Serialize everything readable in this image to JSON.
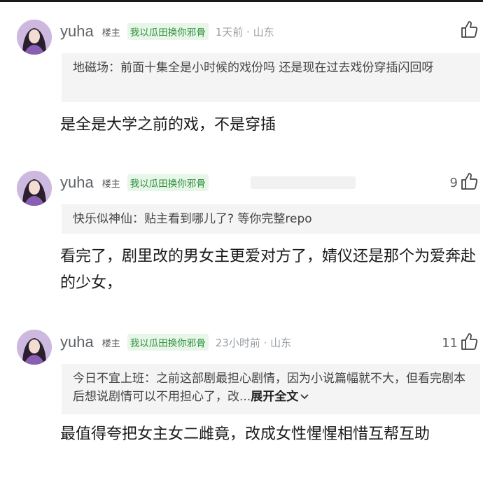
{
  "comments": [
    {
      "username": "yuha",
      "op_badge": "楼主",
      "tag": "我以瓜田换你邪骨",
      "time_location": "1天前 · 山东",
      "like_count": "",
      "quote_user": "地磁场：",
      "quote_text": "前面十集全是小时候的戏份吗 还是现在过去戏份穿插闪回呀",
      "body": "是全是大学之前的戏，不是穿插"
    },
    {
      "username": "yuha",
      "op_badge": "楼主",
      "tag": "我以瓜田换你邪骨",
      "time_location": "",
      "like_count": "9",
      "quote_user": "快乐似神仙：",
      "quote_text": "贴主看到哪儿了? 等你完整repo",
      "body": "看完了，剧里改的男女主更爱对方了，婧仪还是那个为爱奔赴的少女，"
    },
    {
      "username": "yuha",
      "op_badge": "楼主",
      "tag": "我以瓜田换你邪骨",
      "time_location": "23小时前 · 山东",
      "like_count": "11",
      "quote_user": "今日不宜上班：",
      "quote_text": "之前这部剧最担心剧情，因为小说篇幅就不大，但看完剧本后想说剧情可以不用担心了，改...",
      "expand_label": "展开全文",
      "body": "最值得夸把女主女二雌竟，改成女性惺惺相惜互帮互助"
    }
  ],
  "colors": {
    "tag_green": "#2f8f3a",
    "tag_bg": "#e7f6e8",
    "muted": "#9aa0a6",
    "quote_bg": "#f4f4f4"
  },
  "icons": {
    "like": "thumbs-up-icon",
    "expand": "chevron-down-icon"
  }
}
